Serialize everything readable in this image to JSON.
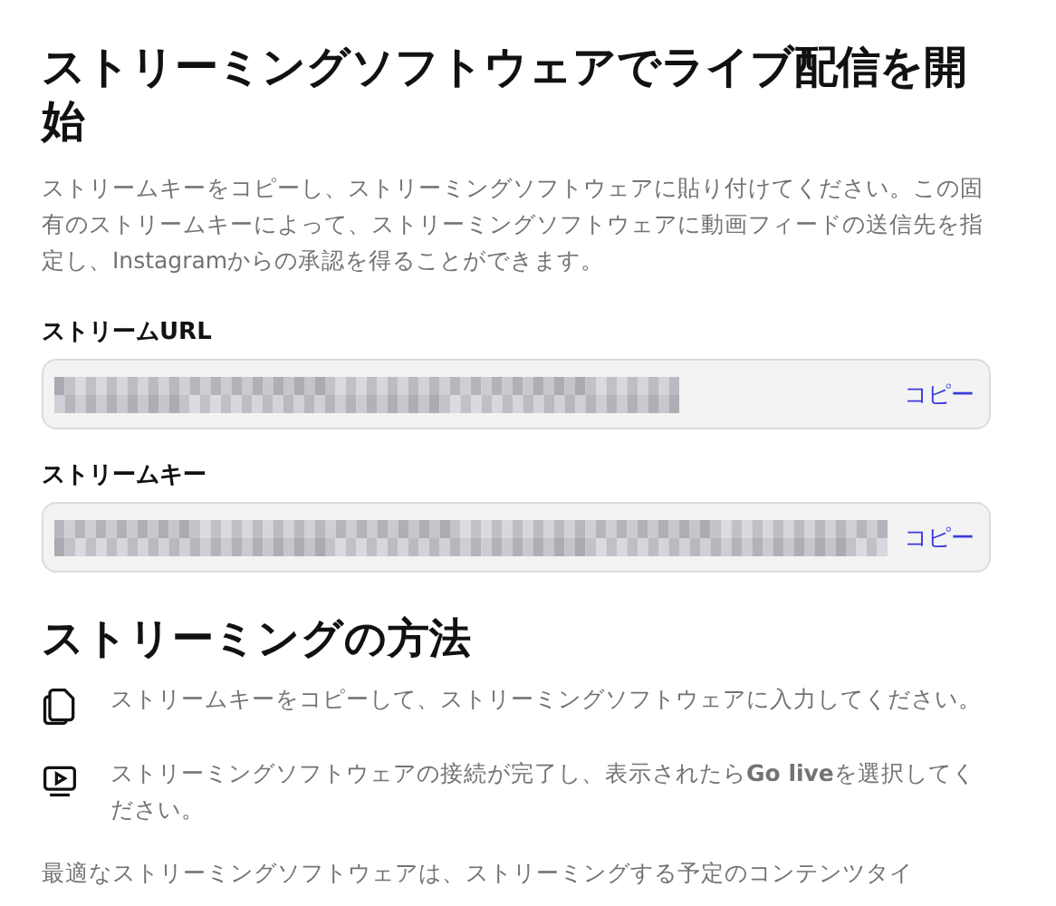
{
  "title": "ストリーミングソフトウェアでライブ配信を開始",
  "description": "ストリームキーをコピーし、ストリーミングソフトウェアに貼り付けてください。この固有のストリームキーによって、ストリーミングソフトウェアに動画フィードの送信先を指定し、Instagramからの承認を得ることができます。",
  "fields": [
    {
      "label": "ストリームURL",
      "value_redacted": true,
      "copy_label": "コピー"
    },
    {
      "label": "ストリームキー",
      "value_redacted": true,
      "copy_label": "コピー"
    }
  ],
  "how_to": {
    "heading": "ストリーミングの方法",
    "steps": [
      {
        "kind": "copy",
        "text": "ストリームキーをコピーして、ストリーミングソフトウェアに入力してください。"
      },
      {
        "kind": "play",
        "text": "ストリーミングソフトウェアの接続が完了し、表示されたら**Go live**を選択してください。"
      }
    ]
  },
  "footer_text": "最適なストリーミングソフトウェアは、ストリーミングする予定のコンテンツタイ"
}
